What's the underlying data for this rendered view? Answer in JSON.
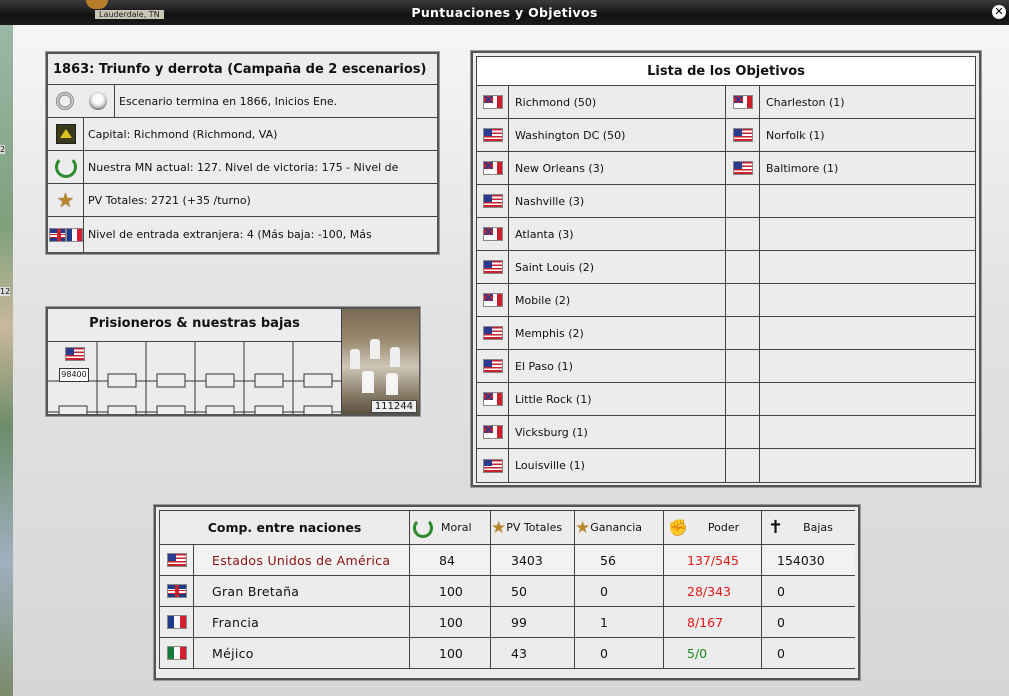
{
  "window": {
    "title": "Puntuaciones y Objetivos",
    "map_label": "Lauderdale, TN"
  },
  "left_strip": {
    "items": [
      "2",
      "12"
    ]
  },
  "scenario": {
    "title": "1863: Triunfo y derrota (Campaña de 2 escenarios)",
    "rows": [
      {
        "icon": "clock-skull-icon",
        "text": "Escenario termina en 1866, Inicios Ene."
      },
      {
        "icon": "capital-icon",
        "text": "Capital: Richmond (Richmond, VA)"
      },
      {
        "icon": "laurel-icon",
        "text": "Nuestra MN actual: 127. Nivel de victoria: 175 - Nivel de"
      },
      {
        "icon": "star-icon",
        "text": "PV Totales: 2721 (+35 /turno)"
      },
      {
        "icon": "foreign-flags-icon",
        "text": "Nivel de entrada extranjera: 4  (Más baja: -100, Más"
      }
    ]
  },
  "prisoners": {
    "title": "Prisioneros & nuestras bajas",
    "first_value": "98400",
    "casualties": "111244"
  },
  "objectives": {
    "title": "Lista de los Objetivos",
    "left": [
      {
        "flag": "cs",
        "name": "Richmond (50)"
      },
      {
        "flag": "us",
        "name": "Washington DC (50)"
      },
      {
        "flag": "cs",
        "name": "New Orleans (3)"
      },
      {
        "flag": "us",
        "name": "Nashville (3)"
      },
      {
        "flag": "cs",
        "name": "Atlanta (3)"
      },
      {
        "flag": "us",
        "name": "Saint Louis (2)"
      },
      {
        "flag": "cs",
        "name": "Mobile (2)"
      },
      {
        "flag": "us",
        "name": "Memphis (2)"
      },
      {
        "flag": "us",
        "name": "El Paso (1)"
      },
      {
        "flag": "cs",
        "name": "Little Rock (1)"
      },
      {
        "flag": "cs",
        "name": "Vicksburg (1)"
      },
      {
        "flag": "us",
        "name": "Louisville (1)"
      }
    ],
    "right": [
      {
        "flag": "cs",
        "name": "Charleston (1)"
      },
      {
        "flag": "us",
        "name": "Norfolk (1)"
      },
      {
        "flag": "us",
        "name": "Baltimore (1)"
      }
    ]
  },
  "nations": {
    "headers": {
      "name": "Comp. entre naciones",
      "moral": "Moral",
      "pv": "PV Totales",
      "gain": "Ganancia",
      "power": "Poder",
      "losses": "Bajas"
    },
    "rows": [
      {
        "flag": "us",
        "name": "Estados Unidos de América",
        "moral": "84",
        "pv": "3403",
        "gain": "56",
        "power": "137/545",
        "losses": "154030",
        "highlight": true
      },
      {
        "flag": "uk",
        "name": "Gran Bretaña",
        "moral": "100",
        "pv": "50",
        "gain": "0",
        "power": "28/343",
        "losses": "0"
      },
      {
        "flag": "fr",
        "name": "Francia",
        "moral": "100",
        "pv": "99",
        "gain": "1",
        "power": "8/167",
        "losses": "0"
      },
      {
        "flag": "mx",
        "name": "Méjico",
        "moral": "100",
        "pv": "43",
        "gain": "0",
        "power": "5/0",
        "losses": "0"
      }
    ]
  },
  "colors": {
    "highlight_name": "#8a1010",
    "power_red": "#e01818",
    "power_green": "#1a8a1a"
  }
}
